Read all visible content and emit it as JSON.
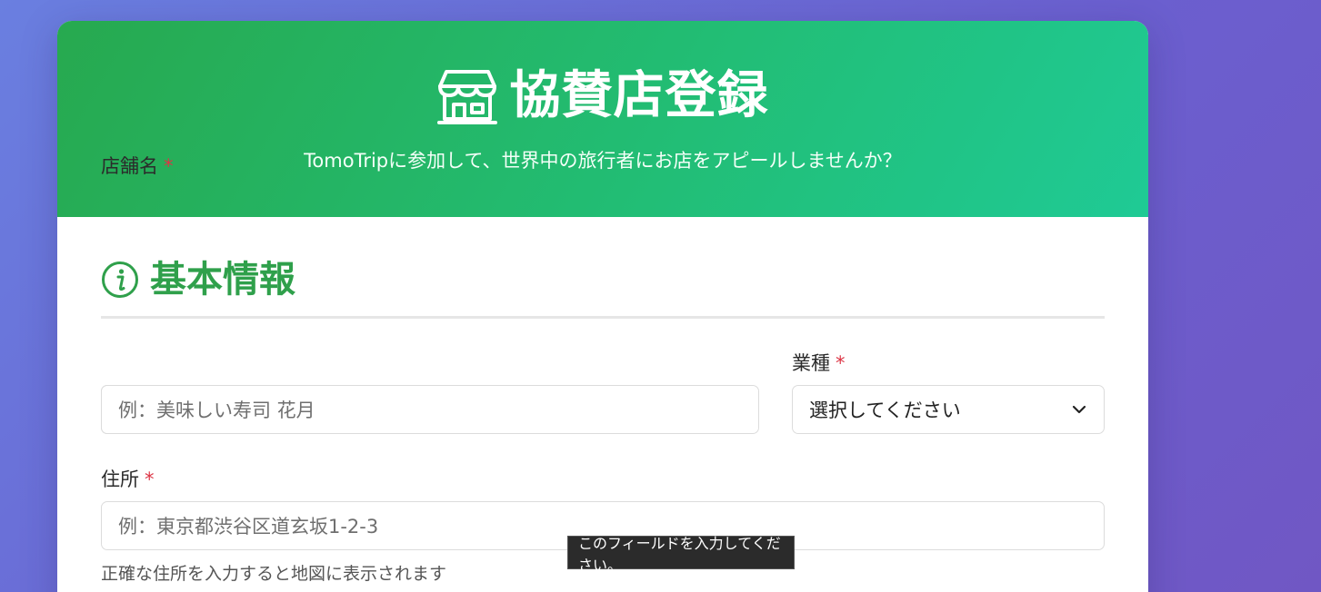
{
  "header": {
    "title": "協賛店登録",
    "subtitle": "TomoTripに参加して、世界中の旅行者にお店をアピールしませんか？",
    "icon": "store-icon"
  },
  "section": {
    "title": "基本情報",
    "icon": "info-icon"
  },
  "fields": {
    "store_name": {
      "label": "店舗名",
      "required_mark": "*",
      "placeholder": "例：美味しい寿司 花月"
    },
    "category": {
      "label": "業種",
      "required_mark": "*",
      "selected": "選択してください"
    },
    "address": {
      "label": "住所",
      "required_mark": "*",
      "placeholder": "例：東京都渋谷区道玄坂1-2-3",
      "help": "正確な住所を入力すると地図に表示されます"
    }
  },
  "tooltip": {
    "text": "このフィールドを入力してください。"
  },
  "colors": {
    "accent_green": "#2fa04b",
    "required_red": "#dc3545",
    "header_gradient_start": "#27a94f",
    "header_gradient_end": "#1fca95"
  }
}
